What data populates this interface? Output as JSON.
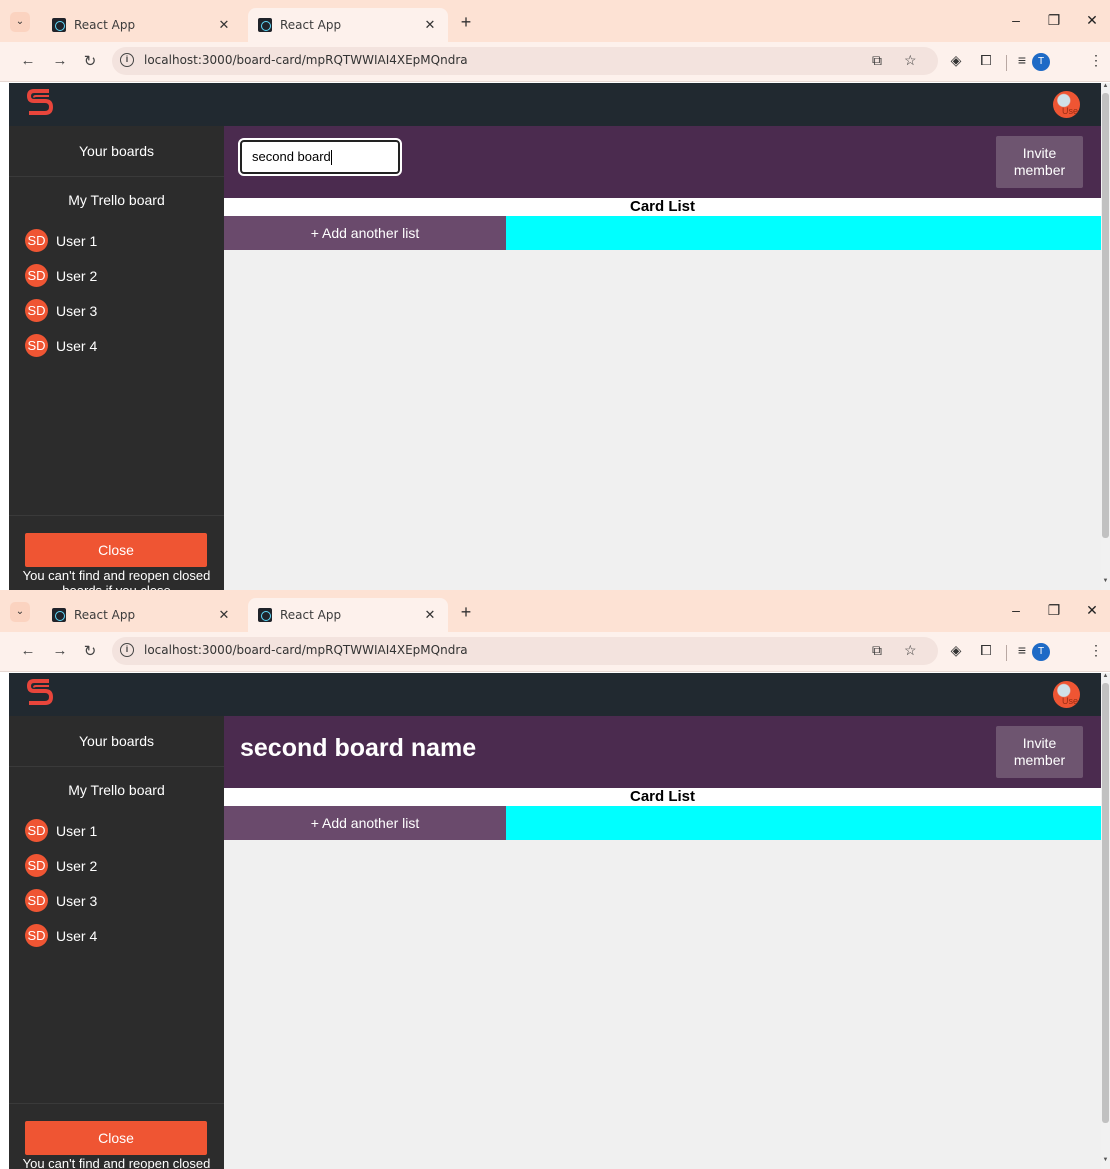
{
  "browser": {
    "tabs": [
      {
        "title": "React App"
      },
      {
        "title": "React App"
      }
    ],
    "url": "localhost:3000/board-card/mpRQTWWIAI4XEpMQndra",
    "profile_initial": "T"
  },
  "app": {
    "user_avatar_text": "Use",
    "sidebar": {
      "title": "Your boards",
      "board_name": "My Trello board",
      "users": [
        {
          "initials": "SD",
          "name": "User 1"
        },
        {
          "initials": "SD",
          "name": "User 2"
        },
        {
          "initials": "SD",
          "name": "User 3"
        },
        {
          "initials": "SD",
          "name": "User 4"
        }
      ],
      "close_label": "Close",
      "close_note": "You can't find and reopen closed boards if you close"
    },
    "invite_label_1": "Invite",
    "invite_label_2": "member",
    "card_list_label": "Card List",
    "add_list_label": "+ Add another list",
    "brand_color": "#ef5533",
    "list_color": "#00ffff"
  },
  "frame1": {
    "board_input_value": "second board"
  },
  "frame2": {
    "board_title": "second board name"
  }
}
